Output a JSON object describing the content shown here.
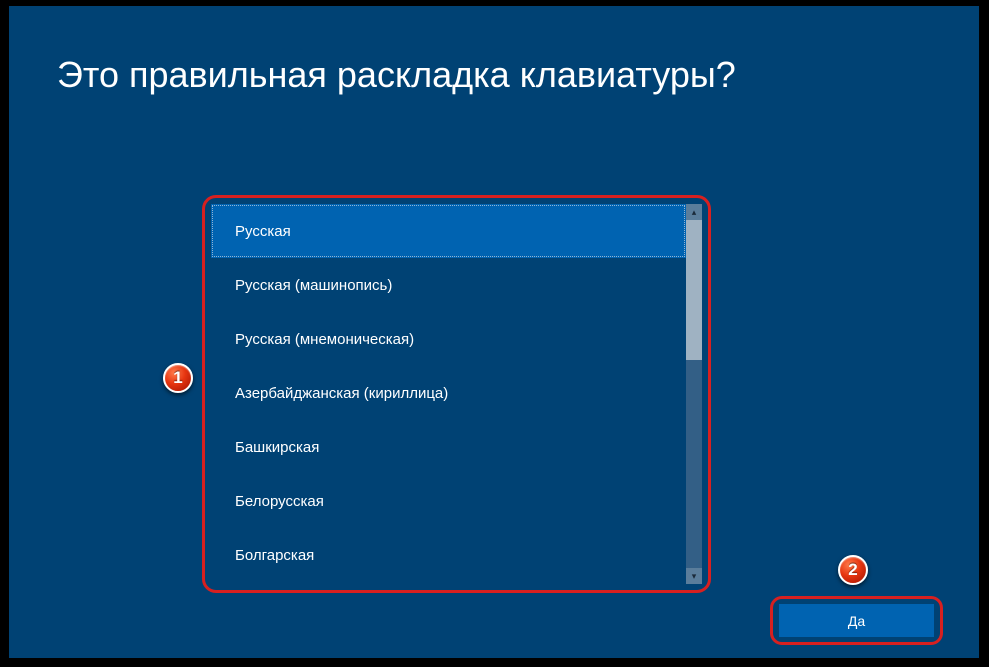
{
  "title": "Это правильная раскладка клавиатуры?",
  "layouts": [
    {
      "label": "Русская",
      "selected": true
    },
    {
      "label": "Русская (машинопись)",
      "selected": false
    },
    {
      "label": "Русская (мнемоническая)",
      "selected": false
    },
    {
      "label": "Азербайджанская (кириллица)",
      "selected": false
    },
    {
      "label": "Башкирская",
      "selected": false
    },
    {
      "label": "Белорусская",
      "selected": false
    },
    {
      "label": "Болгарская",
      "selected": false
    }
  ],
  "confirm_label": "Да",
  "badges": {
    "one": "1",
    "two": "2"
  },
  "scroll": {
    "up_glyph": "▴",
    "down_glyph": "▾"
  }
}
